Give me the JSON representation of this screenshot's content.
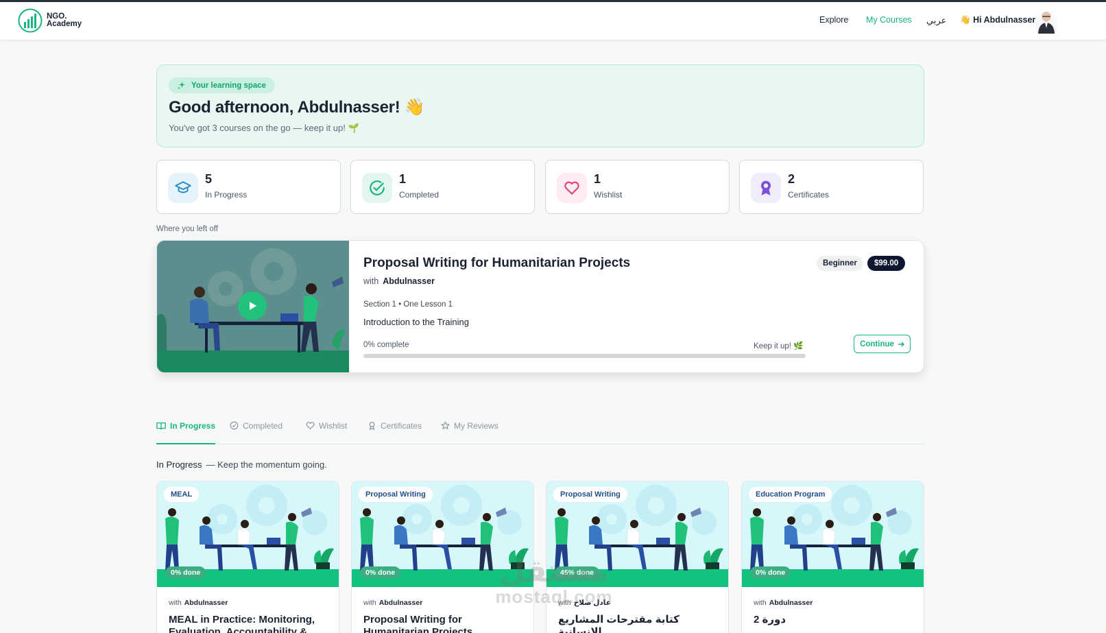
{
  "brand": {
    "line1": "NGO.",
    "line2": "Academy"
  },
  "nav": {
    "explore": "Explore",
    "my_courses": "My Courses",
    "language": "عربي",
    "greeting": "Hi Abdulnasser",
    "greeting_emoji": "👋"
  },
  "hero": {
    "pill": "Your learning space",
    "title": "Good afternoon, Abdulnasser!",
    "title_emoji": "👋",
    "subtitle": "You've got 3 courses on the go — keep it up! 🌱"
  },
  "stats": [
    {
      "value": "5",
      "label": "In Progress",
      "icon": "graduation-cap-icon",
      "color": "#2a8dc4"
    },
    {
      "value": "1",
      "label": "Completed",
      "icon": "check-circle-icon",
      "color": "#18b47e"
    },
    {
      "value": "1",
      "label": "Wishlist",
      "icon": "heart-icon",
      "color": "#e0447c"
    },
    {
      "value": "2",
      "label": "Certificates",
      "icon": "award-icon",
      "color": "#7b50d8"
    }
  ],
  "resume": {
    "caption": "Where you left off",
    "title": "Proposal Writing for Humanitarian Projects",
    "with": "with",
    "instructor": "Abdulnasser",
    "section": "Section 1 • One Lesson 1",
    "lesson": "Introduction to the Training",
    "progress_label": "0% complete",
    "progress": 0,
    "keep": "Keep it up! 🌿",
    "level": "Beginner",
    "price": "$99.00",
    "continue": "Continue"
  },
  "tabs": [
    {
      "label": "In Progress",
      "icon": "book-open-icon",
      "active": true
    },
    {
      "label": "Completed",
      "icon": "check-circle-icon",
      "active": false
    },
    {
      "label": "Wishlist",
      "icon": "heart-icon",
      "active": false
    },
    {
      "label": "Certificates",
      "icon": "award-icon",
      "active": false
    },
    {
      "label": "My Reviews",
      "icon": "star-icon",
      "active": false
    }
  ],
  "list_header": {
    "title": "In Progress",
    "tagline": "— Keep the momentum going."
  },
  "courses": [
    {
      "category": "MEAL",
      "done": "0% done",
      "with": "with",
      "instructor": "Abdulnasser",
      "title": "MEAL in Practice: Monitoring, Evaluation, Accountability &",
      "dir": "ltr"
    },
    {
      "category": "Proposal Writing",
      "done": "0% done",
      "with": "with",
      "instructor": "Abdulnasser",
      "title": "Proposal Writing for Humanitarian Projects",
      "dir": "ltr"
    },
    {
      "category": "Proposal Writing",
      "done": "45% done",
      "with": "with",
      "instructor": "عادل صلاح",
      "title": "كتابة مقترحات المشاريع الإنسانية",
      "dir": "rtl"
    },
    {
      "category": "Education Program",
      "done": "0% done",
      "with": "with",
      "instructor": "Abdulnasser",
      "title": "دورة 2",
      "dir": "rtl"
    }
  ],
  "watermark": {
    "line1": "مستقل",
    "line2": "mostaql.com"
  },
  "colors": {
    "accent": "#18b47e",
    "dark": "#0e1730",
    "hero_bg": "#e9f7f3"
  }
}
